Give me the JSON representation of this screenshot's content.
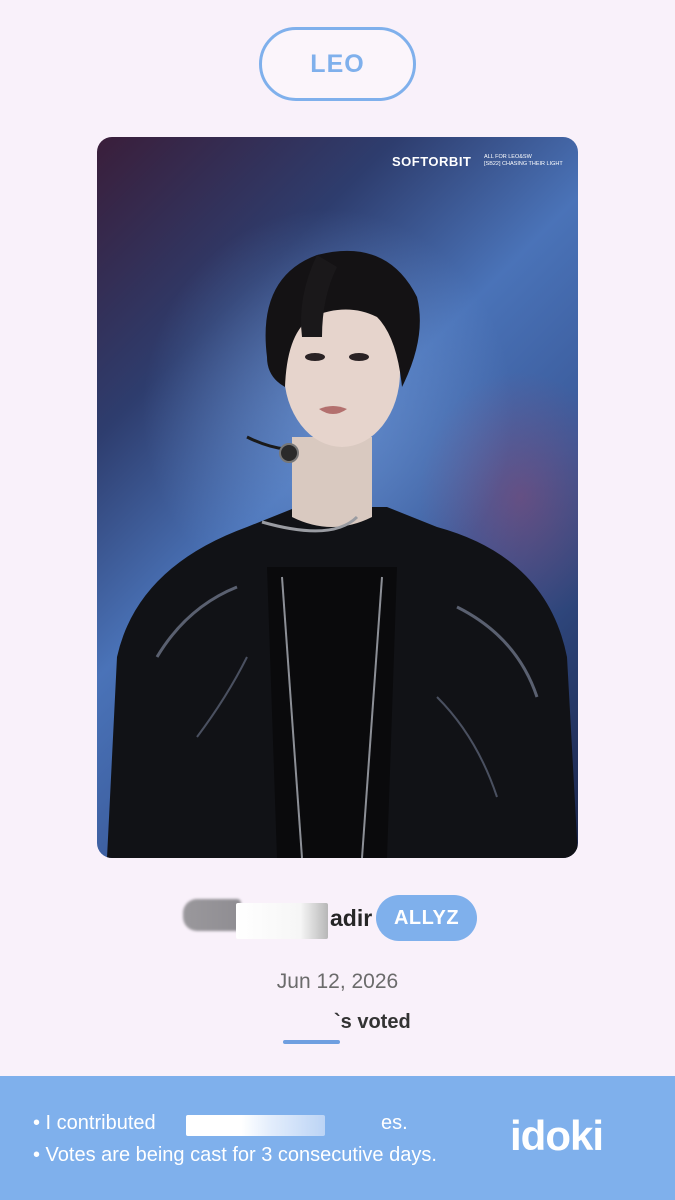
{
  "header": {
    "member_name": "LEO"
  },
  "photo": {
    "watermark_brand": "SOFTORBIT",
    "watermark_line1": "ALL FOR LEO&SW",
    "watermark_line2": "[SB22] CHASING THEIR LIGHT",
    "subject_icon": "person-photo-icon"
  },
  "user": {
    "name_suffix": "adir",
    "team_badge": "ALLYZ"
  },
  "vote": {
    "date": "Jun 12, 2026",
    "voted_text": "`s voted"
  },
  "footer": {
    "line1_prefix": "• I contributed",
    "line1_suffix": "es.",
    "line2": "• Votes are being cast for 3 consecutive days.",
    "brand": "idoki",
    "background_color": "#7fb0ec"
  },
  "colors": {
    "accent": "#7fb0ec",
    "page_background": "#f9f1fa"
  }
}
